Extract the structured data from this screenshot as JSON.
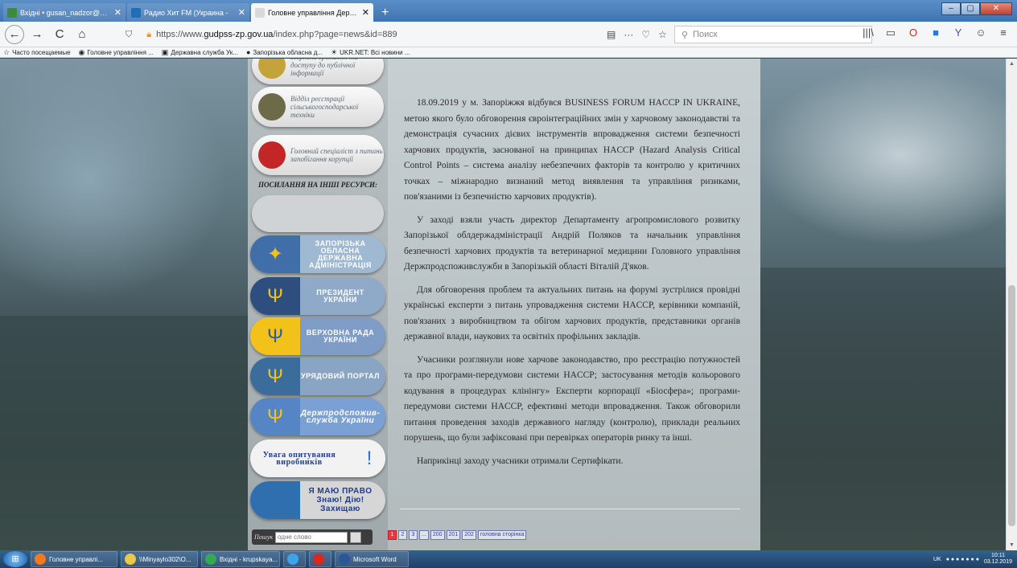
{
  "browser": {
    "tabs": [
      {
        "label": "Вхідні • gusan_nadzor@ukr.net",
        "icon_color": "#3c8a3e",
        "active": false
      },
      {
        "label": "Радио Хит FM (Украина - ",
        "icon_color": "#1f6fb8",
        "active": false
      },
      {
        "label": "Головне управління Держпродс",
        "icon_color": "#d9d9d9",
        "active": true
      }
    ],
    "new_tab": "+",
    "window_controls": [
      "–",
      "▢",
      "✕"
    ],
    "nav": {
      "back": "←",
      "forward": "→",
      "reload": "C",
      "home": "⌂"
    },
    "url_prefix": "https://www.",
    "url_host": "gudpss-zp.gov.ua",
    "url_path": "/index.php?page=news&id=889",
    "url_actions": [
      "▤",
      "···",
      "♡",
      "☆"
    ],
    "search_placeholder": "Поиск",
    "toolbar_icons": [
      "|||\\",
      "▭",
      "O",
      "■",
      "Y",
      "☺",
      "≡"
    ],
    "bookmarks": [
      {
        "icon": "☆",
        "label": "Часто посещаемые"
      },
      {
        "icon": "◉",
        "label": "Головне управління ..."
      },
      {
        "icon": "▣",
        "label": "Державна служба Ук..."
      },
      {
        "icon": "●",
        "label": "Запорізька обласна д..."
      },
      {
        "icon": "☀",
        "label": "UKR.NET: Всі новини ..."
      }
    ]
  },
  "sidebar": {
    "pills": [
      {
        "text": "звернень громадян та доступу до публічної інформації",
        "img_color": "#c4a43a"
      },
      {
        "text": "Відділ реєстрації сільськогосподарської техніки",
        "img_color": "#6c6a48"
      },
      {
        "text": "Головний спеціаліст з питань запобігання корупції",
        "img_color": "#c22626"
      }
    ],
    "links_heading": "ПОСИЛАННЯ НА ІНШІ РЕСУРСИ:",
    "banners": [
      {
        "text": "ЗАПОРІЗЬКА ОБЛАСНА ДЕРЖАВНА АДМІНІСТРАЦІЯ",
        "bg": "#9fb9d2",
        "img_bg": "#3f6ea8",
        "glyph": "✦"
      },
      {
        "text": "ПРЕЗИДЕНТ УКРАЇНИ",
        "bg": "#8fa9c8",
        "img_bg": "#2d4e7e",
        "glyph": "Ψ"
      },
      {
        "text": "ВЕРХОВНА РАДА УКРАЇНИ",
        "bg": "#7f9cc6",
        "img_bg": "#f3c21a",
        "glyph": "Ψ"
      },
      {
        "text": "УРЯДОВИЙ ПОРТАЛ",
        "bg": "#8aa5c4",
        "img_bg": "#3b6d9c",
        "glyph": "Ψ"
      },
      {
        "text": "Держпродспожив-служба України",
        "bg": "#7aa0d4",
        "img_bg": "#5585c4",
        "glyph": "Ψ"
      },
      {
        "text": "Увага опитування виробників",
        "bg": "#f2f2f2",
        "img_bg": "#f2f2f2",
        "glyph": "!"
      },
      {
        "text": "Я МАЮ ПРАВО Знаю! Дію! Захищаю",
        "bg": "#d6d6d6",
        "img_bg": "#2f6fb0",
        "glyph": ""
      }
    ],
    "search_label": "Пошук",
    "search_placeholder": "одне слово"
  },
  "article": {
    "paragraphs": [
      "18.09.2019 у м. Запоріжжя відбувся BUSINESS FORUM HACCP IN UKRAINE, метою якого було обговорення євроінтеграційних змін у харчовому законодавстві та демонстрація сучасних дієвих інструментів впровадження системи безпечності харчових продуктів, заснованої на принципах HACCP (Hazard Analysis Critical Control Points – система аналізу небезпечних факторів та контролю у критичних точках – міжнародно визнаний метод виявлення та управління ризиками, пов'язаними із безпечністю харчових продуктів).",
      "У заході взяли участь директор Департаменту агропромислового розвитку Запорізької облдержадміністрації Андрій Поляков та начальник управління безпечності харчових продуктів та ветеринарної медицини Головного управління Держпродспоживслужби в Запорізькій області Віталій Д'яков.",
      "Для обговорення проблем та актуальних питань на форумі зустрілися провідні українські експерти з питань упровадження системи HACCP, керівники компаній, пов'язаних з виробництвом та обігом харчових продуктів, представники органів державної влади, наукових та освітніх профільних закладів.",
      "Учасники розглянули нове харчове законодавство, про реєстрацію потужностей та про програми-передумови системи HACCP; застосування методів кольорового кодування в процедурах клінінгу» Експерти корпорації «Біосфера»; програми-передумови системи HACCP, ефективні методи впровадження. Також обговорили питання проведення заходів державного нагляду (контролю), приклади реальних порушень, що були зафіксовані при перевірках операторів ринку та інші.",
      "Наприкінці заходу учасники отримали Сертифікати."
    ]
  },
  "pager": [
    "1",
    "2",
    "3",
    "...",
    "200",
    "201",
    "202",
    "головна сторінка"
  ],
  "taskbar": {
    "start": "⊞",
    "tasks": [
      {
        "label": "Головне управлі...",
        "icon_color": "#f07a1d",
        "width": 108
      },
      {
        "label": "\\\\Minyaylo302\\O...",
        "icon_color": "#e9c84a",
        "width": 96
      },
      {
        "label": "Вхідні - krupskaya...",
        "icon_color": "#34a853",
        "width": 98
      },
      {
        "label": "",
        "icon_color": "#3fa3e8",
        "width": 28
      },
      {
        "label": "",
        "icon_color": "#d8281f",
        "width": 28
      },
      {
        "label": "Microsoft Word",
        "icon_color": "#2b5797",
        "width": 92
      }
    ],
    "lang": "UK",
    "time": "10:11",
    "date": "03.12.2019"
  }
}
